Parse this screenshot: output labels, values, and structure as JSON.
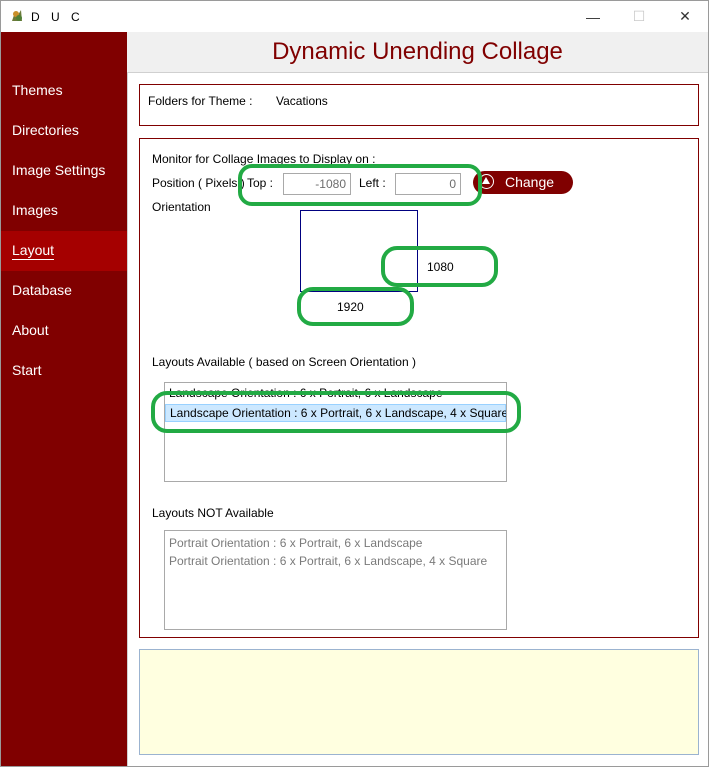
{
  "window": {
    "title": "D U C",
    "controls": {
      "minimize": "—",
      "maximize": "☐",
      "close": "✕"
    }
  },
  "sidebar": {
    "items": [
      {
        "label": "Themes",
        "active": false
      },
      {
        "label": "Directories",
        "active": false
      },
      {
        "label": "Image Settings",
        "active": false
      },
      {
        "label": "Images",
        "active": false
      },
      {
        "label": "Layout",
        "active": true
      },
      {
        "label": "Database",
        "active": false
      },
      {
        "label": "About",
        "active": false
      },
      {
        "label": "Start",
        "active": false
      }
    ]
  },
  "header": {
    "title": "Dynamic Unending Collage"
  },
  "theme": {
    "label": "Folders for Theme :",
    "value": "Vacations"
  },
  "monitor": {
    "heading": "Monitor for Collage Images to Display on :",
    "position_label": "Position ( Pixels )",
    "top_label": "Top :",
    "top_value": "-1080",
    "left_label": "Left :",
    "left_value": "0",
    "change_label": "Change",
    "orientation_label": "Orientation",
    "height_value": "1080",
    "width_value": "1920"
  },
  "layouts_available": {
    "heading": "Layouts Available ( based on Screen Orientation )",
    "items": [
      {
        "label": "Landscape Orientation : 6 x Portrait, 6 x Landscape"
      },
      {
        "label": "Landscape Orientation : 6 x Portrait, 6 x Landscape, 4 x Square",
        "selected": true
      }
    ]
  },
  "layouts_not_available": {
    "heading": "Layouts NOT Available",
    "items": [
      {
        "label": "Portrait Orientation : 6 x Portrait, 6 x Landscape"
      },
      {
        "label": "Portrait Orientation : 6 x Portrait, 6 x Landscape, 4 x Square"
      }
    ]
  },
  "colors": {
    "accent": "#800000",
    "active_nav": "#a50000",
    "highlight": "#22aa44",
    "info_panel": "#ffffe0"
  }
}
